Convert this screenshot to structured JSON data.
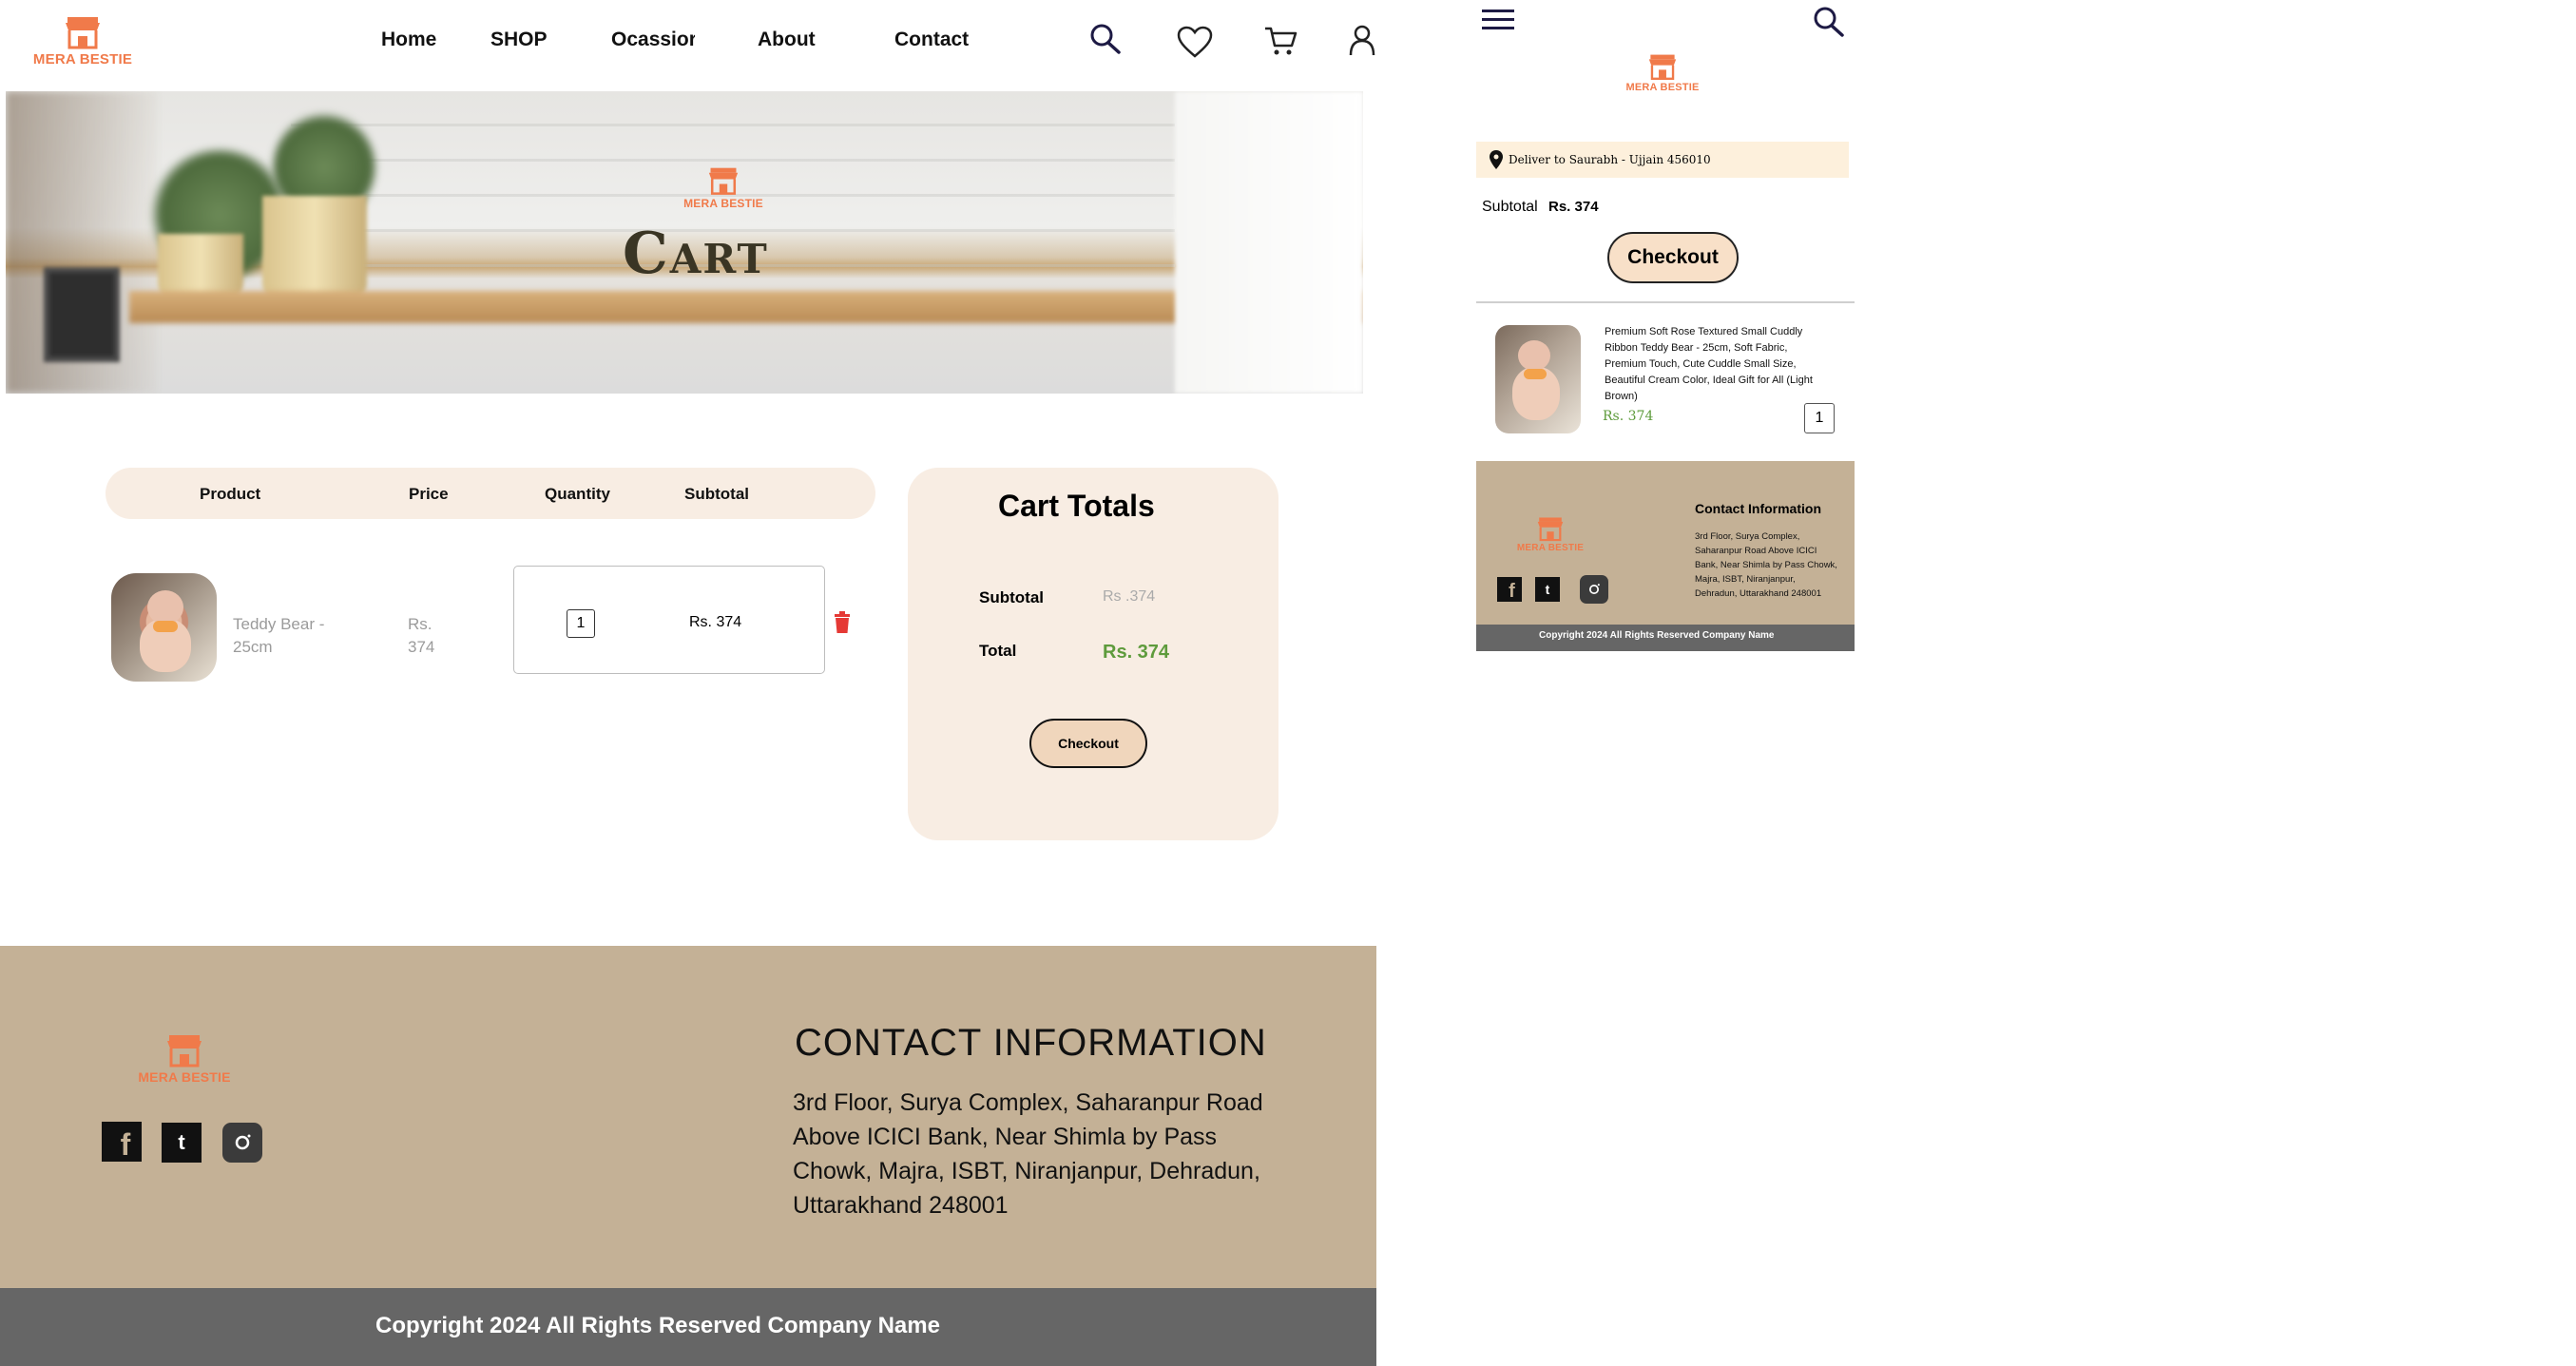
{
  "brand": {
    "logo_text": "MERA BESTIE",
    "accent": "#f07a4a"
  },
  "nav": {
    "items": [
      "Home",
      "SHOP",
      "Ocassior",
      "About",
      "Contact"
    ]
  },
  "hero": {
    "title": "Cart"
  },
  "cart_table": {
    "headers": {
      "product": "Product",
      "price": "Price",
      "quantity": "Quantity",
      "subtotal": "Subtotal"
    },
    "row": {
      "name_line1": "Teddy Bear -",
      "name_line2": "25cm",
      "price_line1": "Rs.",
      "price_line2": "374",
      "quantity": "1",
      "subtotal": "Rs. 374"
    }
  },
  "totals": {
    "title": "Cart Totals",
    "subtotal_label": "Subtotal",
    "subtotal_value": "Rs .374",
    "total_label": "Total",
    "total_value": "Rs. 374",
    "checkout_label": "Checkout",
    "total_color": "#5e9b3c"
  },
  "footer": {
    "contact_title": "CONTACT INFORMATION",
    "address_lines": [
      "3rd Floor, Surya Complex, Saharanpur Road",
      "Above ICICI Bank, Near Shimla by Pass",
      "Chowk, Majra, ISBT, Niranjanpur, Dehradun,",
      "Uttarakhand 248001"
    ],
    "copyright": "Copyright 2024 All Rights Reserved Company Name",
    "social": [
      "facebook-icon",
      "twitter-icon",
      "instagram-icon"
    ]
  },
  "mobile": {
    "deliver_to": "Deliver to Saurabh - Ujjain 456010",
    "subtotal_label": "Subtotal",
    "subtotal_value": "Rs. 374",
    "checkout_label": "Checkout",
    "product_lines": [
      "Premium Soft Rose Textured Small Cuddly",
      "Ribbon Teddy Bear - 25cm, Soft Fabric,",
      "Premium Touch, Cute Cuddle Small Size,",
      "Beautiful Cream Color, Ideal Gift for All (Light",
      "Brown)"
    ],
    "product_price": "Rs. 374",
    "quantity": "1",
    "contact_title": "Contact Information",
    "address_lines": [
      "3rd Floor, Surya Complex,",
      "Saharanpur Road Above ICICI",
      "Bank, Near Shimla by Pass Chowk,",
      "Majra, ISBT, Niranjanpur,",
      "Dehradun, Uttarakhand 248001"
    ],
    "copyright": "Copyright 2024 All Rights Reserved Company Name"
  }
}
